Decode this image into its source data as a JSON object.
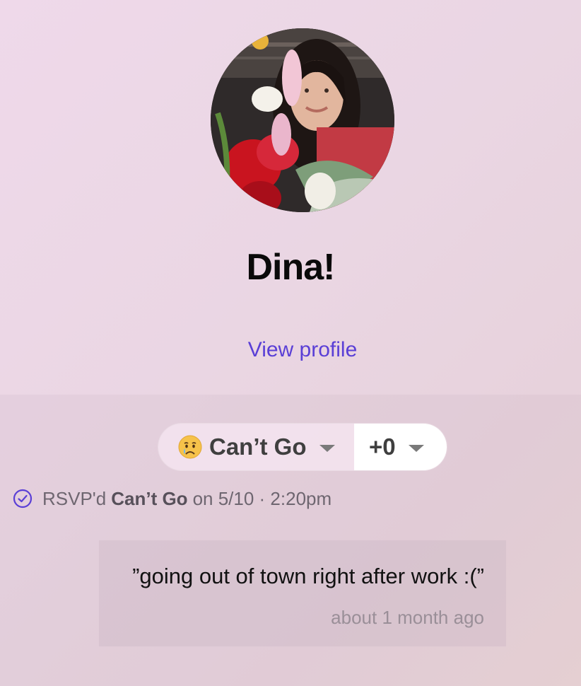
{
  "profile": {
    "name": "Dina!",
    "view_profile_label": "View profile",
    "avatar_icon": "profile-photo"
  },
  "rsvp": {
    "status_emoji": "crying-face",
    "status_label": "Can’t Go",
    "plus_label": "+0",
    "history": {
      "prefix": "RSVP'd",
      "status": "Can’t Go",
      "suffix": "on 5/10 · 2:20pm"
    }
  },
  "comment": {
    "text": "”going out of town right after work :(”",
    "time": "about 1 month ago"
  },
  "colors": {
    "accent": "#5a3fd6",
    "text_dark": "#0a0a0a",
    "muted": "#6e6670"
  }
}
